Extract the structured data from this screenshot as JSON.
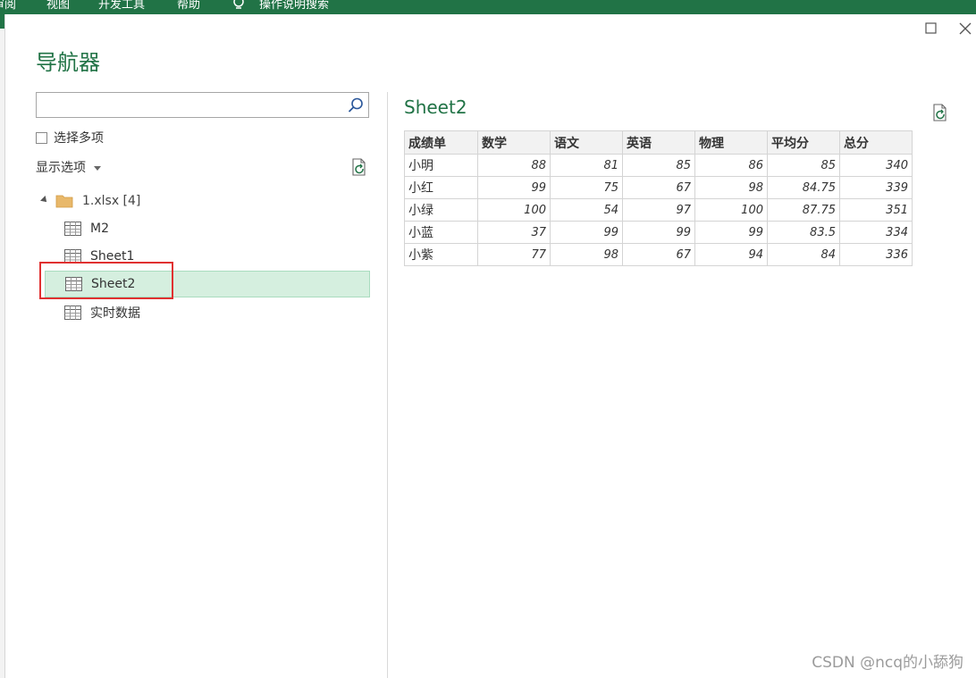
{
  "ribbon": {
    "tabs": [
      "审阅",
      "视图",
      "开发工具",
      "帮助",
      "操作说明搜索"
    ]
  },
  "navigator": {
    "title": "导航器",
    "search": {
      "value": "",
      "placeholder": ""
    },
    "select_multiple_label": "选择多项",
    "display_options_label": "显示选项",
    "tree": {
      "root_label": "1.xlsx [4]",
      "items": [
        "M2",
        "Sheet1",
        "Sheet2",
        "实时数据"
      ],
      "selected_index": 2
    }
  },
  "preview": {
    "title": "Sheet2",
    "headers": [
      "成绩单",
      "数学",
      "语文",
      "英语",
      "物理",
      "平均分",
      "总分"
    ],
    "rows": [
      [
        "小明",
        "88",
        "81",
        "85",
        "86",
        "85",
        "340"
      ],
      [
        "小红",
        "99",
        "75",
        "67",
        "98",
        "84.75",
        "339"
      ],
      [
        "小绿",
        "100",
        "54",
        "97",
        "100",
        "87.75",
        "351"
      ],
      [
        "小蓝",
        "37",
        "99",
        "99",
        "99",
        "83.5",
        "334"
      ],
      [
        "小紫",
        "77",
        "98",
        "67",
        "94",
        "84",
        "336"
      ]
    ]
  },
  "watermark": "CSDN @ncq的小舔狗",
  "colors": {
    "ribbon": "#217346",
    "accent": "#217346",
    "selected_bg": "#d5efdf",
    "highlight": "#e03131"
  }
}
